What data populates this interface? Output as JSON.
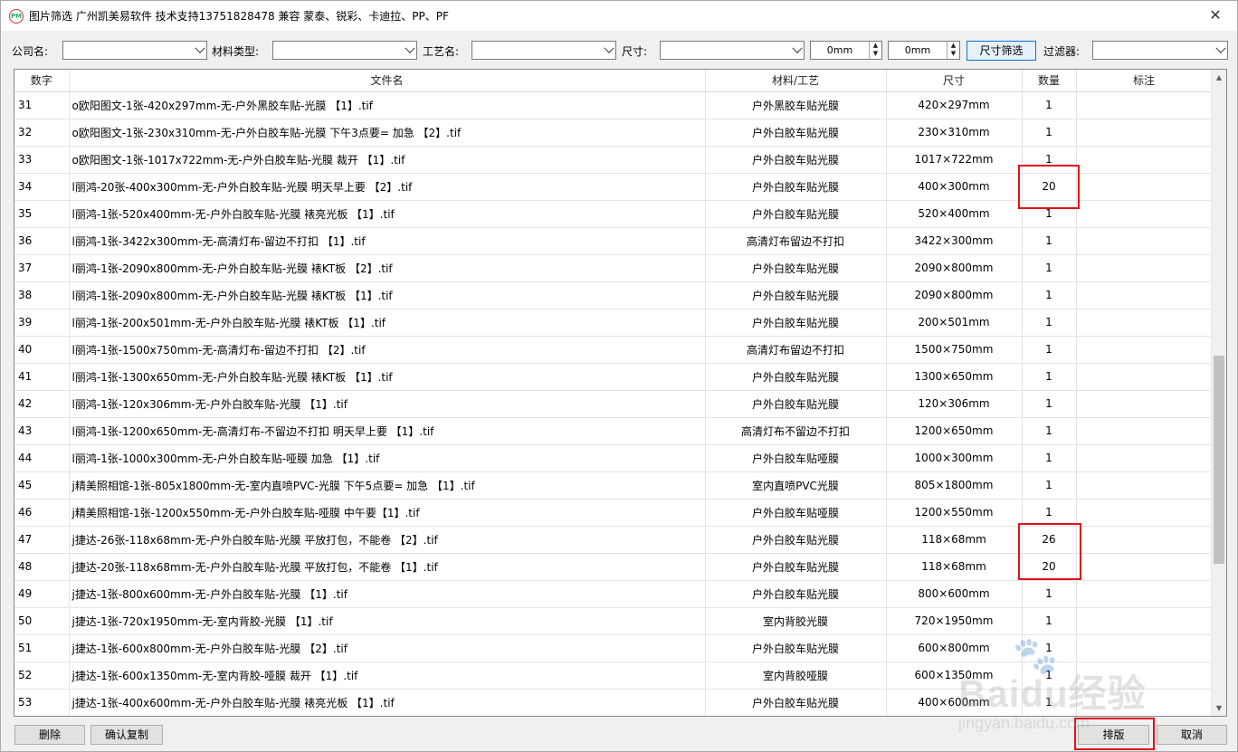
{
  "window": {
    "title": "图片筛选 广州凯美易软件 技术支持13751828478 兼容 蒙泰、锐彩、卡迪拉、PP、PF",
    "icon_label": "PM",
    "close_label": "✕"
  },
  "filters": {
    "company_label": "公司名:",
    "material_label": "材料类型:",
    "process_label": "工艺名:",
    "size_label": "尺寸:",
    "width_value": "0mm",
    "height_value": "0mm",
    "size_filter_button": "尺寸筛选",
    "filter_label": "过滤器:"
  },
  "table": {
    "columns": [
      "数字",
      "文件名",
      "材料/工艺",
      "尺寸",
      "数量",
      "标注"
    ],
    "rows": [
      {
        "num": "31",
        "file": "o欧阳图文-1张-420x297mm-无-户外黑胶车贴-光膜 【1】.tif",
        "material": "户外黑胶车贴光膜",
        "size": "420×297mm",
        "qty": "1",
        "note": ""
      },
      {
        "num": "32",
        "file": "o欧阳图文-1张-230x310mm-无-户外白胶车贴-光膜 下午3点要= 加急 【2】.tif",
        "material": "户外白胶车贴光膜",
        "size": "230×310mm",
        "qty": "1",
        "note": ""
      },
      {
        "num": "33",
        "file": "o欧阳图文-1张-1017x722mm-无-户外白胶车贴-光膜 裁开 【1】.tif",
        "material": "户外白胶车贴光膜",
        "size": "1017×722mm",
        "qty": "1",
        "note": ""
      },
      {
        "num": "34",
        "file": "l丽鸿-20张-400x300mm-无-户外白胶车贴-光膜 明天早上要 【2】.tif",
        "material": "户外白胶车贴光膜",
        "size": "400×300mm",
        "qty": "20",
        "note": ""
      },
      {
        "num": "35",
        "file": "l丽鸿-1张-520x400mm-无-户外白胶车贴-光膜 裱亮光板 【1】.tif",
        "material": "户外白胶车贴光膜",
        "size": "520×400mm",
        "qty": "1",
        "note": ""
      },
      {
        "num": "36",
        "file": "l丽鸿-1张-3422x300mm-无-高清灯布-留边不打扣 【1】.tif",
        "material": "高清灯布留边不打扣",
        "size": "3422×300mm",
        "qty": "1",
        "note": ""
      },
      {
        "num": "37",
        "file": "l丽鸿-1张-2090x800mm-无-户外白胶车贴-光膜 裱KT板 【2】.tif",
        "material": "户外白胶车贴光膜",
        "size": "2090×800mm",
        "qty": "1",
        "note": ""
      },
      {
        "num": "38",
        "file": "l丽鸿-1张-2090x800mm-无-户外白胶车贴-光膜 裱KT板 【1】.tif",
        "material": "户外白胶车贴光膜",
        "size": "2090×800mm",
        "qty": "1",
        "note": ""
      },
      {
        "num": "39",
        "file": "l丽鸿-1张-200x501mm-无-户外白胶车贴-光膜 裱KT板 【1】.tif",
        "material": "户外白胶车贴光膜",
        "size": "200×501mm",
        "qty": "1",
        "note": ""
      },
      {
        "num": "40",
        "file": "l丽鸿-1张-1500x750mm-无-高清灯布-留边不打扣 【2】.tif",
        "material": "高清灯布留边不打扣",
        "size": "1500×750mm",
        "qty": "1",
        "note": ""
      },
      {
        "num": "41",
        "file": "l丽鸿-1张-1300x650mm-无-户外白胶车贴-光膜 裱KT板 【1】.tif",
        "material": "户外白胶车贴光膜",
        "size": "1300×650mm",
        "qty": "1",
        "note": ""
      },
      {
        "num": "42",
        "file": "l丽鸿-1张-120x306mm-无-户外白胶车贴-光膜 【1】.tif",
        "material": "户外白胶车贴光膜",
        "size": "120×306mm",
        "qty": "1",
        "note": ""
      },
      {
        "num": "43",
        "file": "l丽鸿-1张-1200x650mm-无-高清灯布-不留边不打扣 明天早上要 【1】.tif",
        "material": "高清灯布不留边不打扣",
        "size": "1200×650mm",
        "qty": "1",
        "note": ""
      },
      {
        "num": "44",
        "file": "l丽鸿-1张-1000x300mm-无-户外白胶车贴-哑膜 加急 【1】.tif",
        "material": "户外白胶车贴哑膜",
        "size": "1000×300mm",
        "qty": "1",
        "note": ""
      },
      {
        "num": "45",
        "file": "j精美照相馆-1张-805x1800mm-无-室内直喷PVC-光膜 下午5点要= 加急 【1】.tif",
        "material": "室内直喷PVC光膜",
        "size": "805×1800mm",
        "qty": "1",
        "note": ""
      },
      {
        "num": "46",
        "file": "j精美照相馆-1张-1200x550mm-无-户外白胶车贴-哑膜 中午要【1】.tif",
        "material": "户外白胶车贴哑膜",
        "size": "1200×550mm",
        "qty": "1",
        "note": ""
      },
      {
        "num": "47",
        "file": "j捷达-26张-118x68mm-无-户外白胶车贴-光膜 平放打包，不能卷 【2】.tif",
        "material": "户外白胶车贴光膜",
        "size": "118×68mm",
        "qty": "26",
        "note": ""
      },
      {
        "num": "48",
        "file": "j捷达-20张-118x68mm-无-户外白胶车贴-光膜 平放打包，不能卷 【1】.tif",
        "material": "户外白胶车贴光膜",
        "size": "118×68mm",
        "qty": "20",
        "note": ""
      },
      {
        "num": "49",
        "file": "j捷达-1张-800x600mm-无-户外白胶车贴-光膜 【1】.tif",
        "material": "户外白胶车贴光膜",
        "size": "800×600mm",
        "qty": "1",
        "note": ""
      },
      {
        "num": "50",
        "file": "j捷达-1张-720x1950mm-无-室内背胶-光膜 【1】.tif",
        "material": "室内背胶光膜",
        "size": "720×1950mm",
        "qty": "1",
        "note": ""
      },
      {
        "num": "51",
        "file": "j捷达-1张-600x800mm-无-户外白胶车贴-光膜 【2】.tif",
        "material": "户外白胶车贴光膜",
        "size": "600×800mm",
        "qty": "1",
        "note": ""
      },
      {
        "num": "52",
        "file": "j捷达-1张-600x1350mm-无-室内背胶-哑膜 裁开 【1】.tif",
        "material": "室内背胶哑膜",
        "size": "600×1350mm",
        "qty": "1",
        "note": ""
      },
      {
        "num": "53",
        "file": "j捷达-1张-400x600mm-无-户外白胶车贴-光膜 裱亮光板 【1】.tif",
        "material": "户外白胶车贴光膜",
        "size": "400×600mm",
        "qty": "1",
        "note": ""
      }
    ]
  },
  "buttons": {
    "delete": "删除",
    "confirm_copy": "确认复制",
    "layout": "排版",
    "cancel": "取消"
  },
  "highlight_color": "#e0101a",
  "watermark": {
    "text": "Baidu经验",
    "url": "jingyan.baidu.com"
  }
}
